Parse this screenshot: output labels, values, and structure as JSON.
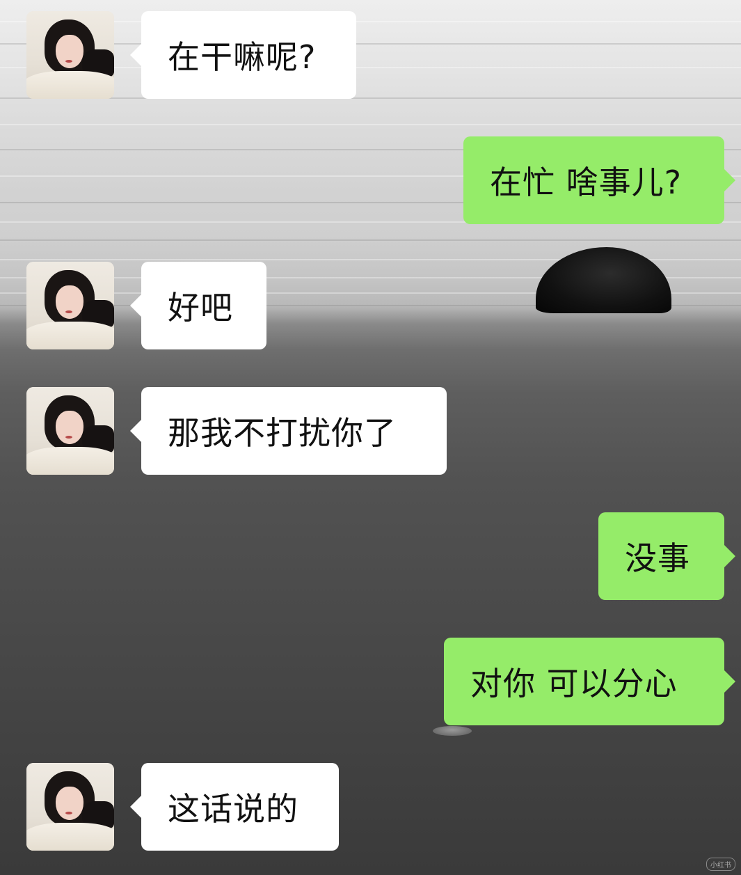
{
  "chat": {
    "messages": [
      {
        "sender": "contact",
        "text": "在干嘛呢?"
      },
      {
        "sender": "me",
        "text": "在忙 啥事儿?"
      },
      {
        "sender": "contact",
        "text": "好吧"
      },
      {
        "sender": "contact",
        "text": "那我不打扰你了"
      },
      {
        "sender": "me",
        "text": "没事"
      },
      {
        "sender": "me",
        "text": "对你 可以分心"
      },
      {
        "sender": "contact",
        "text": "这话说的"
      }
    ]
  },
  "colors": {
    "incoming_bubble": "#ffffff",
    "outgoing_bubble": "#95ec69",
    "text": "#111111"
  },
  "icons": {
    "contact_avatar": "avatar-icon"
  }
}
